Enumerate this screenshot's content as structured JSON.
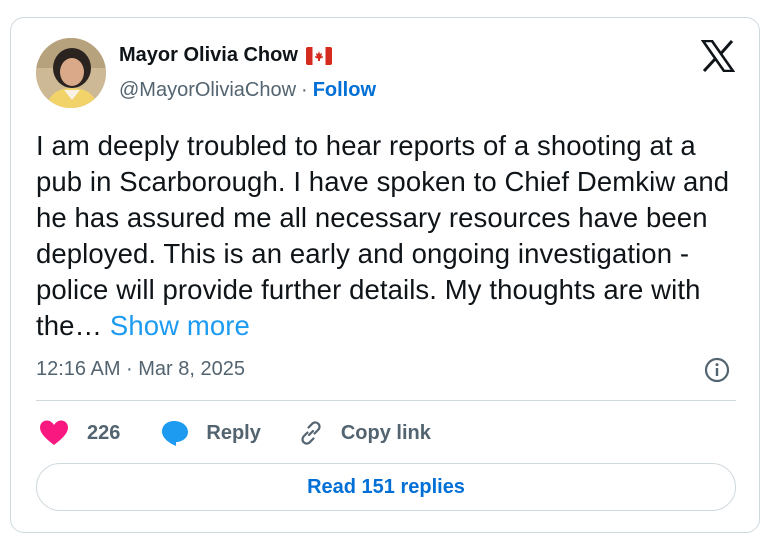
{
  "author": {
    "display_name": "Mayor Olivia Chow",
    "handle": "@MayorOliviaChow",
    "separator": "·",
    "follow_label": "Follow",
    "flag_emoji_name": "canada-flag-icon"
  },
  "tweet": {
    "text": "I am deeply troubled to hear reports of a shooting at a pub in Scarborough. I have spoken to Chief Demkiw and he has assured me all necessary resources have been deployed. This is an early and ongoing investigation - police will provide further details. My thoughts are with the…",
    "show_more_label": "Show more",
    "timestamp": "12:16 AM · Mar 8, 2025"
  },
  "actions": {
    "like_count": "226",
    "reply_label": "Reply",
    "copy_link_label": "Copy link"
  },
  "footer": {
    "read_replies_label": "Read 151 replies"
  },
  "colors": {
    "like_pink": "#f91880",
    "reply_blue": "#1d9bf0",
    "link_blue": "#006fd6",
    "flag_red": "#d52b1e"
  }
}
